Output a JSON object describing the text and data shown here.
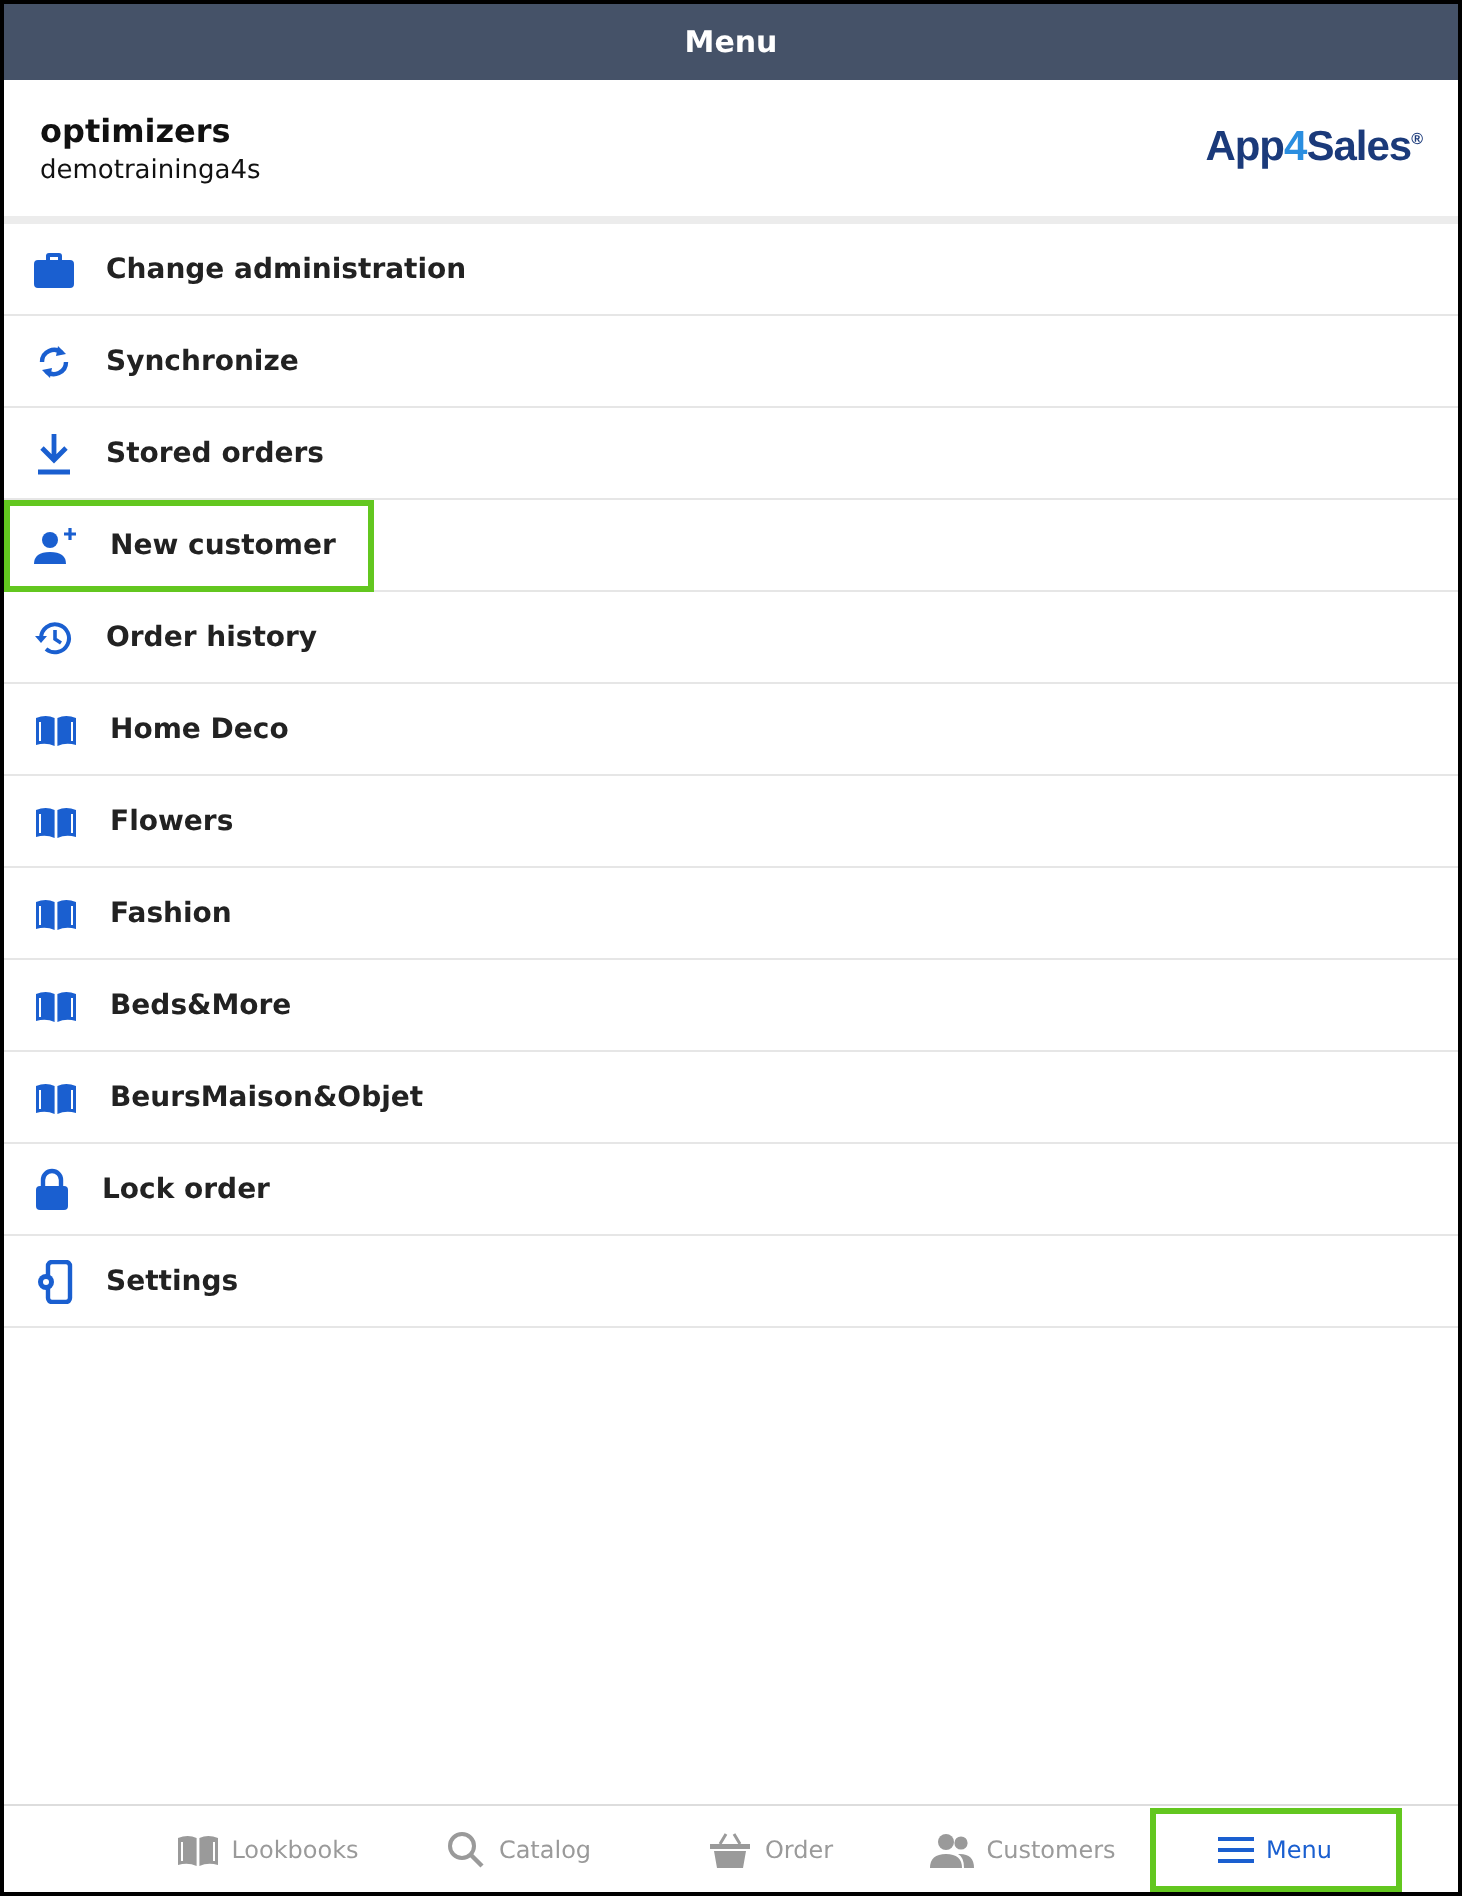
{
  "header": {
    "title": "Menu"
  },
  "account": {
    "name": "optimizers",
    "user": "demotraininga4s"
  },
  "logo": {
    "start": "App",
    "accent": "4",
    "end": "Sales",
    "mark": "®"
  },
  "menu": [
    {
      "kind": "briefcase",
      "label": "Change administration",
      "highlighted": false
    },
    {
      "kind": "sync",
      "label": "Synchronize",
      "highlighted": false
    },
    {
      "kind": "download",
      "label": "Stored orders",
      "highlighted": false
    },
    {
      "kind": "user-plus",
      "label": "New customer",
      "highlighted": true
    },
    {
      "kind": "history",
      "label": "Order history",
      "highlighted": false
    },
    {
      "kind": "book",
      "label": "Home Deco",
      "highlighted": false
    },
    {
      "kind": "book",
      "label": "Flowers",
      "highlighted": false
    },
    {
      "kind": "book",
      "label": "Fashion",
      "highlighted": false
    },
    {
      "kind": "book",
      "label": "Beds&More",
      "highlighted": false
    },
    {
      "kind": "book",
      "label": "BeursMaison&Objet",
      "highlighted": false
    },
    {
      "kind": "lock",
      "label": "Lock order",
      "highlighted": false
    },
    {
      "kind": "settings",
      "label": "Settings",
      "highlighted": false
    }
  ],
  "tabs": [
    {
      "kind": "book",
      "label": "Lookbooks",
      "selected": false,
      "highlighted": false
    },
    {
      "kind": "search",
      "label": "Catalog",
      "selected": false,
      "highlighted": false
    },
    {
      "kind": "basket",
      "label": "Order",
      "selected": false,
      "highlighted": false
    },
    {
      "kind": "users",
      "label": "Customers",
      "selected": false,
      "highlighted": false
    },
    {
      "kind": "menu",
      "label": "Menu",
      "selected": true,
      "highlighted": true
    }
  ]
}
